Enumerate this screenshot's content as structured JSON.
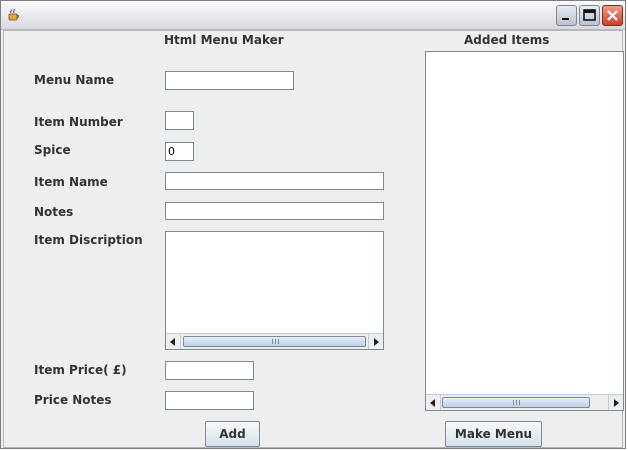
{
  "heading": "Html Menu Maker",
  "added_items_heading": "Added Items",
  "labels": {
    "menu_name": "Menu Name",
    "item_number": "Item Number",
    "spice": "Spice",
    "item_name": "Item Name",
    "notes": "Notes",
    "item_description": "Item Discription",
    "item_price": "Item Price( £)",
    "price_notes": "Price Notes"
  },
  "fields": {
    "menu_name": "",
    "item_number": "",
    "spice": "0",
    "item_name": "",
    "notes": "",
    "item_price": "",
    "price_notes": ""
  },
  "buttons": {
    "add": "Add",
    "make_menu": "Make Menu"
  },
  "icons": {
    "app": "java-coffee-cup-icon",
    "minimize": "minimize-icon",
    "maximize": "maximize-icon",
    "close": "close-icon"
  }
}
